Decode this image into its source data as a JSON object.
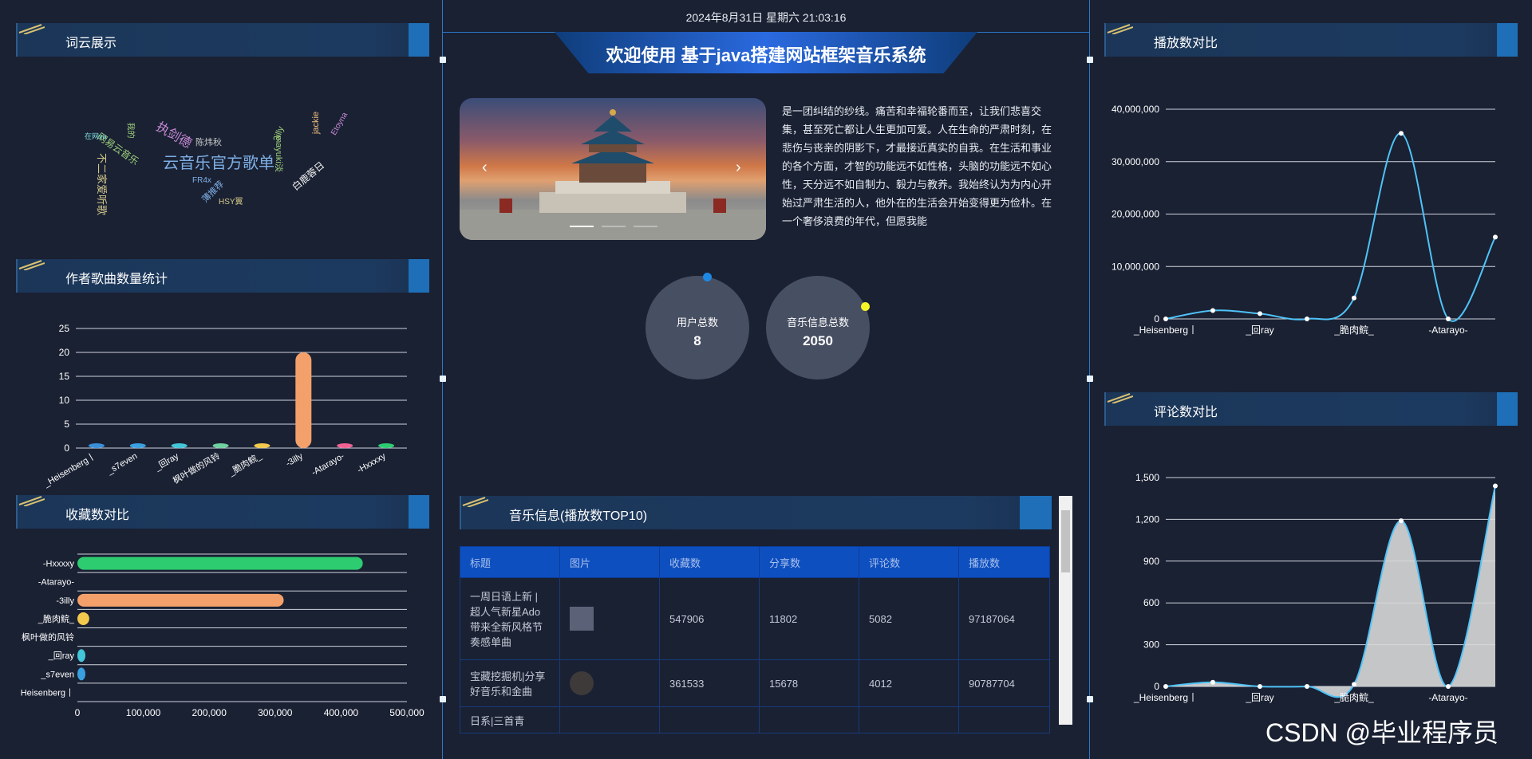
{
  "header": {
    "date": "2024年8月31日 星期六 21:03:16",
    "title": "欢迎使用 基于java搭建网站框架音乐系统"
  },
  "panels": {
    "wordcloud": "词云展示",
    "author_stats": "作者歌曲数量统计",
    "collect": "收藏数对比",
    "play": "播放数对比",
    "comment": "评论数对比",
    "music_top": "音乐信息(播放数TOP10)"
  },
  "wordcloud": {
    "words": [
      {
        "text": "云音乐官方歌单",
        "color": "#7fb0e6"
      },
      {
        "text": "执剑德",
        "color": "#c98cd8"
      },
      {
        "text": "不二家爱听歌",
        "color": "#d4c98a"
      },
      {
        "text": "网易云音乐",
        "color": "#9ed07a"
      },
      {
        "text": "陈炜秋",
        "color": "#c8c8c8"
      },
      {
        "text": "白鹿蓉日",
        "color": "#f0f0f0"
      },
      {
        "text": "mayuki淡",
        "color": "#9ed07a"
      },
      {
        "text": "3illy",
        "color": "#9ed07a"
      },
      {
        "text": "FR4x",
        "color": "#7fb0e6"
      },
      {
        "text": "HSY翼",
        "color": "#d4c98a"
      },
      {
        "text": "薄推荐",
        "color": "#7fb0e6"
      },
      {
        "text": "Etoyna",
        "color": "#c98cd8"
      },
      {
        "text": "jackie",
        "color": "#f0c080"
      },
      {
        "text": "在网ya",
        "color": "#7fe0e0"
      },
      {
        "text": "我的",
        "color": "#9ed07a"
      }
    ]
  },
  "carousel": {
    "prev": "‹",
    "next": "›"
  },
  "description": "是一团纠结的纱线。痛苦和幸福轮番而至，让我们悲喜交集，甚至死亡都让人生更加可爱。人在生命的严肃时刻，在悲伤与丧亲的阴影下，才最接近真实的自我。在生活和事业的各个方面，才智的功能远不如性格，头脑的功能远不如心性，天分远不如自制力、毅力与教养。我始终认为为内心开始过严肃生活的人，他外在的生活会开始变得更为俭朴。在一个奢侈浪费的年代，但愿我能",
  "stats": {
    "users_label": "用户总数",
    "users_value": "8",
    "music_label": "音乐信息总数",
    "music_value": "2050"
  },
  "table": {
    "headers": [
      "标题",
      "图片",
      "收藏数",
      "分享数",
      "评论数",
      "播放数"
    ],
    "rows": [
      {
        "title": "一周日语上新 | 超人气新星Ado带来全新风格节奏感单曲",
        "collect": "547906",
        "share": "11802",
        "comment": "5082",
        "play": "97187064"
      },
      {
        "title": "宝藏挖掘机|分享好音乐和金曲",
        "collect": "361533",
        "share": "15678",
        "comment": "4012",
        "play": "90787704"
      },
      {
        "title": "日系|三首青",
        "collect": "",
        "share": "",
        "comment": "",
        "play": ""
      }
    ]
  },
  "watermark": "CSDN @毕业程序员",
  "colors": {
    "accent": "#2c78c6",
    "bg": "#1a2133",
    "line": "#4fc3f7"
  },
  "chart_data": [
    {
      "type": "bar",
      "title": "作者歌曲数量统计",
      "categories": [
        "_Heisenberg丨",
        "_s7even",
        "_回ray",
        "枫叶做的风铃",
        "_脆肉鲩_",
        "-3illy",
        "-Atarayo-",
        "-Hxxxxy"
      ],
      "values": [
        1,
        1,
        1,
        1,
        1,
        20,
        1,
        1
      ],
      "colors": [
        "#3a8fd9",
        "#3aa0e0",
        "#43c6d8",
        "#6fd0a0",
        "#f2c94c",
        "#f4a06b",
        "#f06292",
        "#2ecc71"
      ],
      "ylim": [
        0,
        25
      ],
      "yticks": [
        "0",
        "5",
        "10",
        "15",
        "20",
        "25"
      ],
      "xticks": [
        "_Heisenberg丨",
        "_s7even",
        "_回ray",
        "枫叶做的风铃",
        "_脆肉鲩_",
        "-3illy",
        "-Atarayo-",
        "-Hxxxxy"
      ]
    },
    {
      "type": "bar",
      "orientation": "horizontal",
      "title": "收藏数对比",
      "categories": [
        "-Hxxxxy",
        "-Atarayo-",
        "-3illy",
        "_脆肉鲩_",
        "枫叶做的风铃",
        "_回ray",
        "_s7even",
        "Heisenberg丨"
      ],
      "values": [
        433000,
        0,
        313000,
        18000,
        0,
        4000,
        12000,
        0
      ],
      "colors": [
        "#2ecc71",
        "#f06292",
        "#f4a06b",
        "#f2c94c",
        "#6fd0a0",
        "#43c6d8",
        "#3aa0e0",
        "#3a8fd9"
      ],
      "xlim": [
        0,
        500000
      ],
      "xticks": [
        "0",
        "100,000",
        "200,000",
        "300,000",
        "400,000",
        "500,000"
      ]
    },
    {
      "type": "line",
      "title": "播放数对比",
      "x": [
        "_Heisenberg丨",
        "_s7even",
        "_回ray",
        "枫叶做的风铃",
        "_脆肉鲩_",
        "-3illy",
        "-Atarayo-",
        "-Hxxxxy"
      ],
      "values": [
        0,
        1600000,
        1000000,
        0,
        4000000,
        35400000,
        0,
        15600000
      ],
      "ylim": [
        0,
        40000000
      ],
      "yticks": [
        "0",
        "10,000,000",
        "20,000,000",
        "30,000,000",
        "40,000,000"
      ],
      "xticks": [
        "_Heisenberg丨",
        "_回ray",
        "_脆肉鲩_",
        "-Atarayo-"
      ]
    },
    {
      "type": "area",
      "title": "评论数对比",
      "x": [
        "_Heisenberg丨",
        "_s7even",
        "_回ray",
        "枫叶做的风铃",
        "_脆肉鲩_",
        "-3illy",
        "-Atarayo-",
        "-Hxxxxy"
      ],
      "values": [
        0,
        30,
        0,
        0,
        15,
        1190,
        0,
        1440
      ],
      "ylim": [
        0,
        1500
      ],
      "yticks": [
        "0",
        "300",
        "600",
        "900",
        "1,200",
        "1,500"
      ],
      "xticks": [
        "_Heisenberg丨",
        "_回ray",
        "_脆肉鲩_",
        "-Atarayo-"
      ]
    }
  ]
}
